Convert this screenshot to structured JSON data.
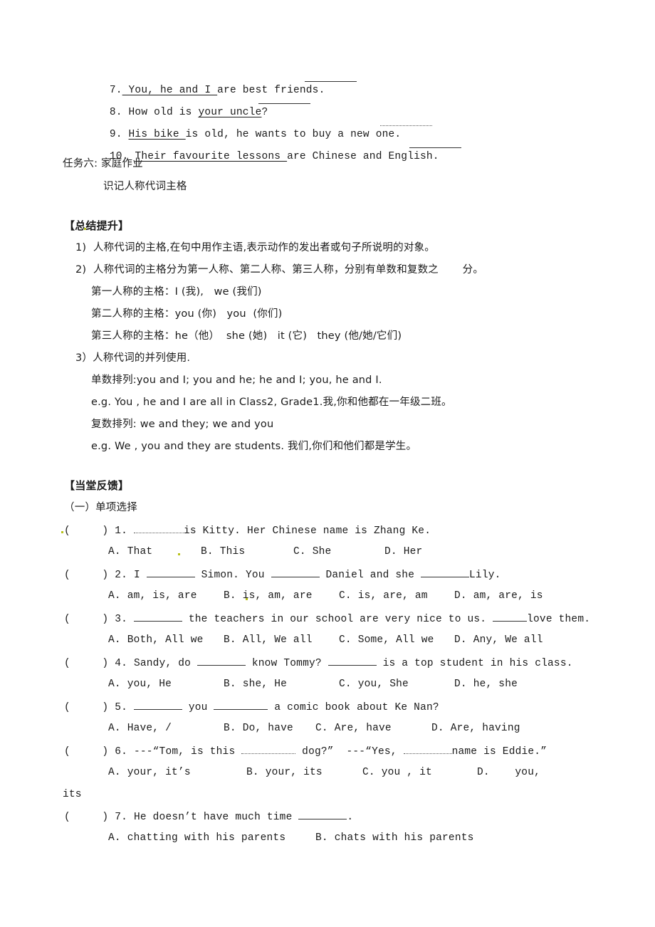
{
  "exercise_part": {
    "items": [
      {
        "num": "7.",
        "underlined": " You, he and I ",
        "rest": "are best friends."
      },
      {
        "num": "8.",
        "pre": "How old is ",
        "underlined": "your uncle",
        "rest": "?"
      },
      {
        "num": "9.",
        "underlined": "His bike ",
        "rest": "is old, he wants to buy a new one."
      },
      {
        "num": "10.",
        "underlined": "Their favourite lessons ",
        "rest": "are Chinese and English."
      }
    ]
  },
  "task6": {
    "title": "任务六: 家庭作业",
    "content": "识记人称代词主格"
  },
  "summary": {
    "heading": "【总结提升】",
    "point1": "1)  人称代词的主格,在句中用作主语,表示动作的发出者或句子所说明的对象。",
    "point2": "2)  人称代词的主格分为第一人称、第二人称、第三人称，分别有单数和复数之       分。",
    "first_person": "第一人称的主格：I (我),   we (我们)",
    "second_person": "第二人称的主格：you (你)   you  (你们)",
    "third_person": "第三人称的主格：he（他）  she (她)   it (它)   they (他/她/它们)",
    "point3": "3）人称代词的并列使用.",
    "singular": "单数排列:you and I; you and he; he and I; you, he and I.",
    "singular_eg": "e.g. You , he and I are all in Class2, Grade1.我,你和他都在一年级二班。",
    "plural": "复数排列: we and they; we and you",
    "plural_eg": "e.g. We , you and they are students. 我们,你们和他们都是学生。"
  },
  "feedback": {
    "heading": "【当堂反馈】",
    "section": "（一）单项选择",
    "questions": [
      {
        "bracket": "(     )",
        "num": "1.",
        "text_parts": [
          "",
          "is Kitty. Her Chinese name is Zhang Ke."
        ],
        "options": [
          "A. That",
          "B. This",
          "C. She",
          "D. Her"
        ]
      },
      {
        "bracket": "(     )",
        "num": "2.",
        "text_parts": [
          "I ",
          " Simon. You ",
          " Daniel and she ",
          "Lily."
        ],
        "options": [
          "A. am, is, are",
          "B. is, am, are",
          "C. is, are, am",
          "D. am, are, is"
        ]
      },
      {
        "bracket": "(     )",
        "num": "3.",
        "text_parts": [
          "",
          " the teachers in our school are very nice to us. ",
          "love them."
        ],
        "options": [
          "A. Both, All we",
          "B. All, We all",
          "C. Some, All we",
          "D. Any, We all"
        ]
      },
      {
        "bracket": "(     )",
        "num": "4.",
        "text_parts": [
          "Sandy, do ",
          " know Tommy? ",
          " is a top student in his class."
        ],
        "options": [
          "A. you, He",
          "B. she, He",
          "C. you, She",
          "D. he, she"
        ]
      },
      {
        "bracket": "(     )",
        "num": "5.",
        "text_parts": [
          "",
          " you ",
          " a comic book about Ke Nan?"
        ],
        "options": [
          "A. Have, /",
          "B. Do, have",
          "C. Are, have",
          "D. Are, having"
        ]
      },
      {
        "bracket": "(     )",
        "num": "6.",
        "text_parts": [
          "---“Tom, is this ",
          " dog?”  ---“Yes, ",
          "name is Eddie.”"
        ],
        "options": [
          "A. your, it’s",
          "B. your, its",
          "C. you , it",
          "D.    you,"
        ],
        "wrap": "its"
      },
      {
        "bracket": "(     )",
        "num": "7.",
        "text_parts": [
          "He doesn’t have much time ",
          "."
        ],
        "options": [
          "A. chatting with his parents",
          "B. chats with his parents"
        ]
      }
    ]
  }
}
